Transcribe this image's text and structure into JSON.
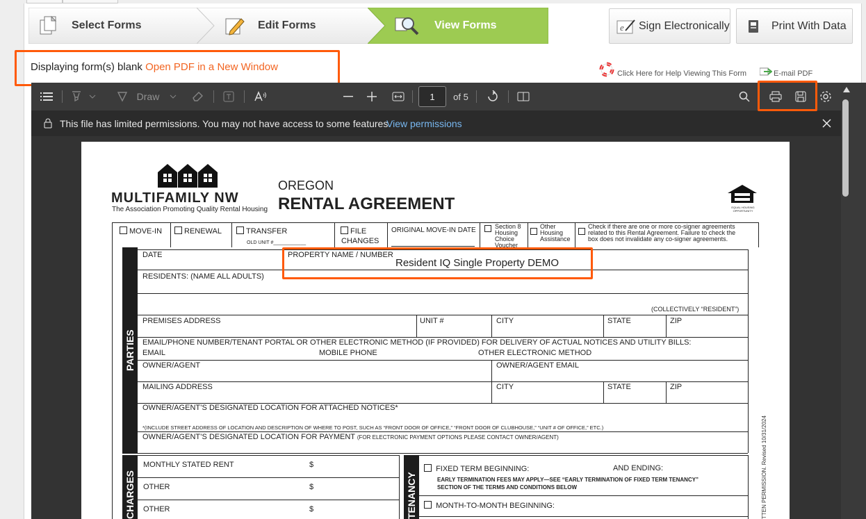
{
  "wizard": {
    "steps": [
      {
        "label": "Select Forms"
      },
      {
        "label": "Edit Forms"
      },
      {
        "label": "View Forms"
      }
    ],
    "sign_label": "Sign Electronically",
    "print_label": "Print With Data"
  },
  "info": {
    "displaying_text": "Displaying form(s) blank",
    "open_pdf_link": "Open PDF in a New Window",
    "help_link": "Click Here for Help Viewing This Form",
    "email_pdf": "E-mail PDF"
  },
  "viewer": {
    "draw_label": "Draw",
    "page_number": "1",
    "page_count": "of 5",
    "permission_text": "This file has limited permissions. You may not have access to some features.",
    "view_permissions": "View permissions"
  },
  "form": {
    "brand": "MULTIFAMILY NW",
    "brand_sub": "The Association Promoting Quality Rental Housing",
    "state": "OREGON",
    "title": "RENTAL AGREEMENT",
    "equal_housing": "EQUAL HOUSING OPPORTUNITY",
    "move_in": "MOVE-IN",
    "renewal": "RENEWAL",
    "transfer": "TRANSFER",
    "old_unit": "OLD UNIT #",
    "file_changes_1": "FILE",
    "file_changes_2": "CHANGES",
    "original_move_in": "ORIGINAL MOVE-IN DATE",
    "section8": [
      "Section 8",
      "Housing",
      "Choice",
      "Voucher"
    ],
    "other_housing": [
      "Other",
      "Housing",
      "Assistance"
    ],
    "cosigner": [
      "Check if there are one or more co-signer agreements",
      "related to this Rental Agreement. Failure to check the",
      "box does not invalidate any co-signer agreements."
    ],
    "parties": "PARTIES",
    "date": "DATE",
    "property_name_label": "PROPERTY NAME / NUMBER",
    "property_name_value": "Resident IQ Single Property DEMO",
    "residents": "RESIDENTS: (NAME ALL ADULTS)",
    "collectively": "(COLLECTIVELY “RESIDENT”)",
    "premises_address": "PREMISES ADDRESS",
    "unit": "UNIT #",
    "city": "CITY",
    "state_lbl": "STATE",
    "zip": "ZIP",
    "email_phone": "EMAIL/PHONE NUMBER/TENANT PORTAL OR OTHER ELECTRONIC METHOD (IF PROVIDED) FOR DELIVERY OF ACTUAL NOTICES AND UTILITY BILLS:",
    "email": "EMAIL",
    "mobile": "MOBILE PHONE",
    "other_elec": "OTHER ELECTRONIC METHOD",
    "owner_agent": "OWNER/AGENT",
    "owner_agent_email": "OWNER/AGENT EMAIL",
    "mailing": "MAILING ADDRESS",
    "designated_notices": "OWNER/AGENT’S DESIGNATED LOCATION FOR ATTACHED NOTICES*",
    "include_note": "*(INCLUDE STREET ADDRESS OF LOCATION AND DESCRIPTION OF WHERE TO POST, SUCH AS “FRONT DOOR OF OFFICE,” “FRONT DOOR OF CLUBHOUSE,” “UNIT # OF OFFICE,” ETC.)",
    "designated_payment": "OWNER/AGENT’S DESIGNATED LOCATION FOR PAYMENT",
    "payment_note": "(FOR ELECTRONIC PAYMENT OPTIONS PLEASE CONTACT OWNER/AGENT)",
    "charges": "CHARGES",
    "monthly_rent": "MONTHLY STATED RENT",
    "other1": "OTHER",
    "other2": "OTHER",
    "dollar": "$",
    "tenancy": "TENANCY",
    "fixed_term": "FIXED TERM BEGINNING:",
    "and_ending": "AND ENDING:",
    "early_term_1": "EARLY TERMINATION FEES MAY APPLY—SEE “EARLY TERMINATION OF FIXED TERM TENANCY”",
    "early_term_2": "SECTION OF THE TERMS AND CONDITIONS BELOW",
    "month_to_month": "MONTH-TO-MONTH BEGINNING:",
    "revised": "TTEN PERMISSION. Revised 10/31/2024"
  }
}
